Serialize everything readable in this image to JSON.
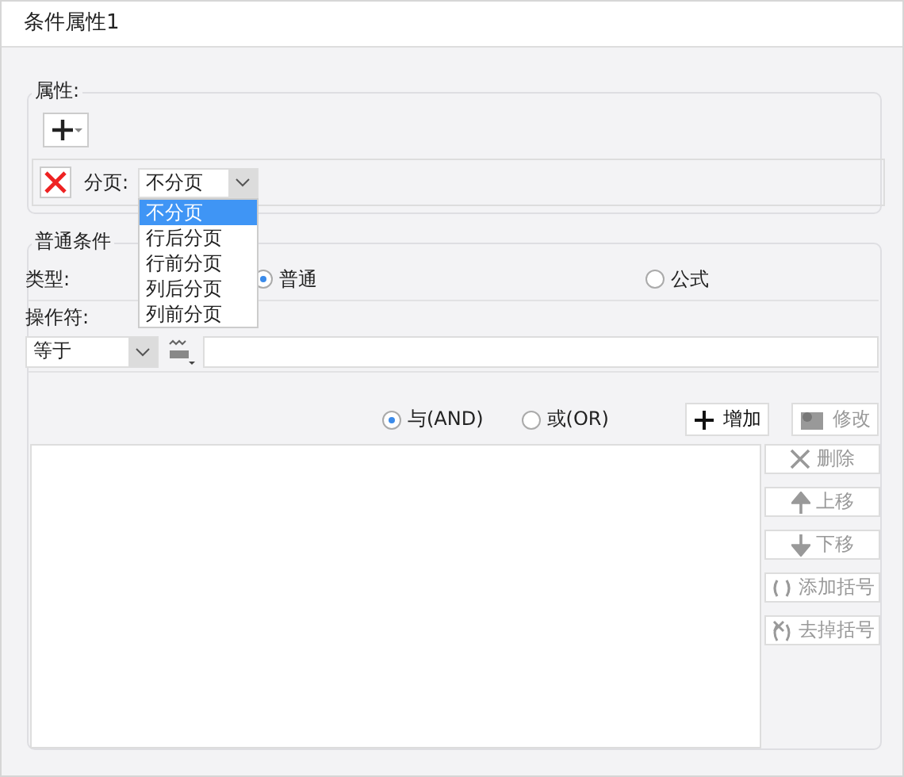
{
  "window": {
    "title": "条件属性1"
  },
  "properties": {
    "legend": "属性:",
    "row": {
      "label": "分页:",
      "value": "不分页",
      "options": [
        {
          "label": "不分页",
          "selected": true
        },
        {
          "label": "行后分页",
          "selected": false
        },
        {
          "label": "行前分页",
          "selected": false
        },
        {
          "label": "列后分页",
          "selected": false
        },
        {
          "label": "列前分页",
          "selected": false
        }
      ]
    }
  },
  "condition": {
    "legend": "普通条件",
    "type_label": "类型:",
    "type_options": [
      {
        "label": "普通",
        "selected": true
      },
      {
        "label": "公式",
        "selected": false
      }
    ],
    "operator_label": "操作符:",
    "operator": "等于",
    "logic": [
      {
        "label": "与(AND)",
        "selected": true
      },
      {
        "label": "或(OR)",
        "selected": false
      }
    ],
    "buttons": [
      {
        "label": "增加",
        "kind": "add",
        "disabled": false
      },
      {
        "label": "修改",
        "kind": "edit",
        "disabled": true
      }
    ],
    "side_buttons": [
      {
        "label": "删除",
        "kind": "delete",
        "disabled": true
      },
      {
        "label": "上移",
        "kind": "up",
        "disabled": true
      },
      {
        "label": "下移",
        "kind": "down",
        "disabled": true
      },
      {
        "label": "添加括号",
        "kind": "add-bracket",
        "disabled": true
      },
      {
        "label": "去掉括号",
        "kind": "remove-bracket",
        "disabled": true
      }
    ]
  }
}
